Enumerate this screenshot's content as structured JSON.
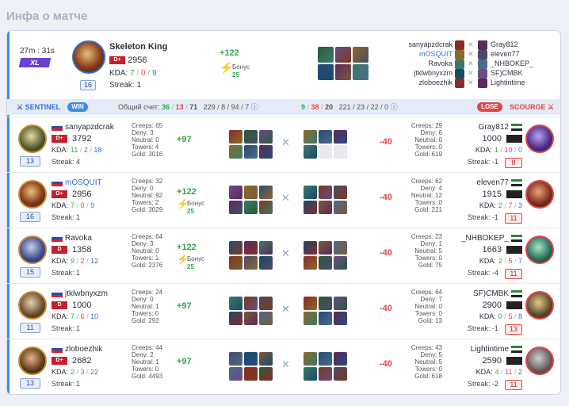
{
  "page_title": "Инфа о матче",
  "match": {
    "duration": "27m : 31s",
    "skill": "XL"
  },
  "best_player": {
    "name": "Skeleton King",
    "rating": "2956",
    "rank": "D+",
    "kda_label": "KDA:",
    "k": "7",
    "d": "0",
    "a": "9",
    "streak": "Streak: 1",
    "level": "16",
    "gain": "+122",
    "bonus_label": "Бонус",
    "bonus_value": "25"
  },
  "opponents": [
    {
      "left": "sanyapzdcrak",
      "right": "Gray812"
    },
    {
      "left": "mOSQUIT",
      "right": "eleven77"
    },
    {
      "left": "Ravoka",
      "right": "_NHBOKEP_"
    },
    {
      "left": "jtklwbnyxzm",
      "right": "SF)CMBK"
    },
    {
      "left": "zloboezhik",
      "right": "Lightintime"
    }
  ],
  "teams": {
    "sentinel": "SENTINEL",
    "win": "WIN",
    "total_label": "Общий счет:",
    "sentinel_k": "36",
    "sentinel_d": "13",
    "sentinel_a": "71",
    "sentinel_extra": "229 / 8 / 94 / 7",
    "scourge_k": "9",
    "scourge_d": "38",
    "scourge_a": "20",
    "scourge_extra": "221 / 23 / 22 / 0",
    "lose": "LOSE",
    "scourge": "SCOURGE"
  },
  "rows": [
    {
      "name": "sanyapzdcrak",
      "rank": "D+",
      "rating": "3792",
      "k": "11",
      "d": "2",
      "a": "18",
      "streak": "Streak: 4",
      "level": "13",
      "stats": [
        "Creeps: 65",
        "Deny: 3",
        "Neutral: 0",
        "Towers: 4",
        "Gold: 3016"
      ],
      "gain": "+97",
      "bonus": false,
      "opp_name": "Gray812",
      "opp_rating": "1000",
      "opp_k": "1",
      "opp_d": "10",
      "opp_a": "0",
      "opp_streak": "Streak: -1",
      "opp_level": "8",
      "opp_stats": [
        "Creeps: 29",
        "Deny: 6",
        "Neutral: 0",
        "Towers: 0",
        "Gold: 619"
      ],
      "loss": "-40"
    },
    {
      "name": "mOSQUIT",
      "rank": "D+",
      "rating": "2956",
      "k": "7",
      "d": "0",
      "a": "9",
      "streak": "Streak: 1",
      "level": "16",
      "stats": [
        "Creeps: 32",
        "Deny: 0",
        "Neutral: 92",
        "Towers: 2",
        "Gold: 3029"
      ],
      "gain": "+122",
      "bonus": true,
      "bonus_label": "Бонус",
      "bonus_value": "25",
      "opp_name": "eleven77",
      "opp_rating": "1915",
      "opp_k": "2",
      "opp_d": "7",
      "opp_a": "3",
      "opp_streak": "Streak: -1",
      "opp_level": "11",
      "opp_stats": [
        "Creeps: 62",
        "Deny: 4",
        "Neutral: 12",
        "Towers: 0",
        "Gold: 221"
      ],
      "loss": "-40"
    },
    {
      "name": "Ravoka",
      "rank": "D",
      "rating": "1358",
      "k": "9",
      "d": "2",
      "a": "12",
      "streak": "Streak: 1",
      "level": "15",
      "stats": [
        "Creeps: 64",
        "Deny: 3",
        "Neutral: 0",
        "Towers: 1",
        "Gold: 2376"
      ],
      "gain": "+122",
      "bonus": true,
      "bonus_label": "Бонус",
      "bonus_value": "25",
      "opp_name": "_NHBOKEP_",
      "opp_rating": "1663",
      "opp_k": "2",
      "opp_d": "5",
      "opp_a": "7",
      "opp_streak": "Streak: -4",
      "opp_level": "11",
      "opp_stats": [
        "Creeps: 23",
        "Deny: 1",
        "Neutral: 5",
        "Towers: 0",
        "Gold: 75"
      ],
      "loss": "-40"
    },
    {
      "name": "jtklwbnyxzm",
      "rank": "D",
      "rating": "1000",
      "k": "7",
      "d": "6",
      "a": "10",
      "streak": "Streak: 1",
      "level": "11",
      "stats": [
        "Creeps: 24",
        "Deny: 0",
        "Neutral: 1",
        "Towers: 0",
        "Gold: 292"
      ],
      "gain": "+97",
      "bonus": false,
      "opp_name": "SF)CMBK",
      "opp_rating": "2900",
      "opp_k": "0",
      "opp_d": "5",
      "opp_a": "8",
      "opp_streak": "Streak: -1",
      "opp_level": "13",
      "opp_stats": [
        "Creeps: 64",
        "Deny: 7",
        "Neutral: 0",
        "Towers: 0",
        "Gold: 13"
      ],
      "loss": "-40"
    },
    {
      "name": "zloboezhik",
      "rank": "D+",
      "rating": "2682",
      "k": "2",
      "d": "3",
      "a": "22",
      "streak": "Streak: 1",
      "level": "13",
      "stats": [
        "Creeps: 44",
        "Deny: 2",
        "Neutral: 1",
        "Towers: 0",
        "Gold: 4493"
      ],
      "gain": "+97",
      "bonus": false,
      "opp_name": "Lightintime",
      "opp_rating": "2590",
      "opp_k": "4",
      "opp_d": "11",
      "opp_a": "2",
      "opp_streak": "Streak: -2",
      "opp_level": "11",
      "opp_stats": [
        "Creeps: 43",
        "Deny: 5",
        "Neutral: 5",
        "Towers: 0",
        "Gold: 618"
      ],
      "loss": "-40"
    }
  ],
  "labels": {
    "kda": "KDA:"
  }
}
